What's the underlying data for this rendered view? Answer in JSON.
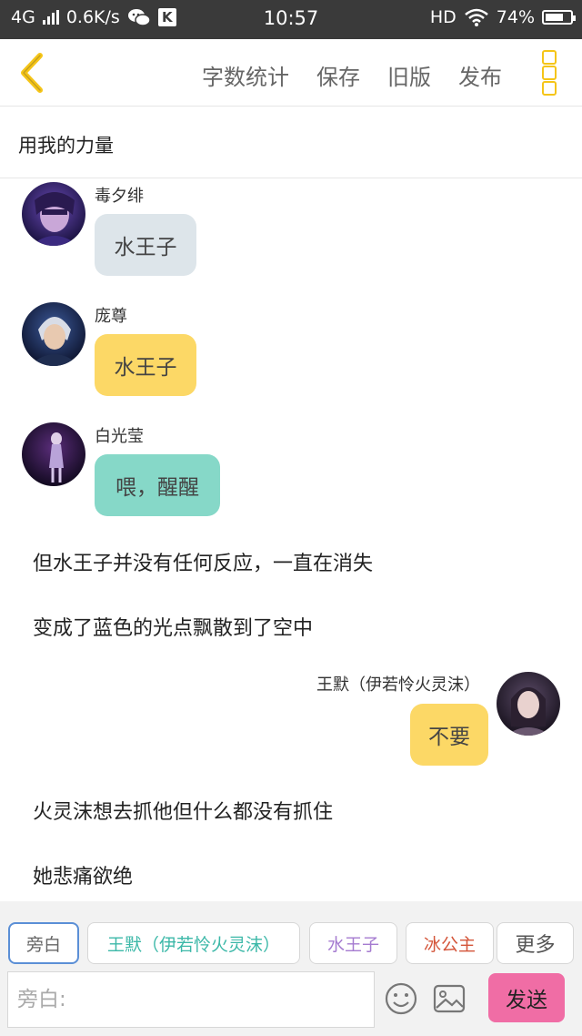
{
  "status_bar": {
    "network": "4G",
    "speed": "0.6K/s",
    "k_badge": "K",
    "time": "10:57",
    "hd": "HD",
    "battery_text": "74%",
    "battery_level": 0.74
  },
  "toolbar": {
    "actions": [
      "字数统计",
      "保存",
      "旧版",
      "发布"
    ],
    "accent_color": "#f5c518"
  },
  "story_title": "用我的力量",
  "messages": [
    {
      "type": "character",
      "name": "毒夕绯",
      "text": "水王子",
      "bubble_color": "#dde5ea"
    },
    {
      "type": "character",
      "name": "庞尊",
      "text": "水王子",
      "bubble_color": "#fcd866"
    },
    {
      "type": "character",
      "name": "白光莹",
      "text": "喂，醒醒",
      "bubble_color": "#86d8c8"
    },
    {
      "type": "narration",
      "text": "但水王子并没有任何反应，一直在消失"
    },
    {
      "type": "narration",
      "text": "变成了蓝色的光点飘散到了空中"
    },
    {
      "type": "self",
      "name": "王默（伊若怜火灵沫）",
      "text": "不要",
      "bubble_color": "#fcd866"
    },
    {
      "type": "narration",
      "text": "火灵沫想去抓他但什么都没有抓住"
    },
    {
      "type": "narration",
      "text": "她悲痛欲绝"
    }
  ],
  "role_chips": [
    {
      "label": "旁白",
      "color": "#666666",
      "active": true
    },
    {
      "label": "王默（伊若怜火灵沫）",
      "color": "#3cb8a8",
      "active": false
    },
    {
      "label": "水王子",
      "color": "#a57bd0",
      "active": false
    },
    {
      "label": "冰公主",
      "color": "#d4553a",
      "active": false
    },
    {
      "label": "更多",
      "color": "#555555",
      "active": false
    }
  ],
  "composer": {
    "placeholder": "旁白:",
    "send_label": "发送",
    "send_color": "#f06da5",
    "icons": [
      "emoji-icon",
      "image-icon"
    ]
  }
}
